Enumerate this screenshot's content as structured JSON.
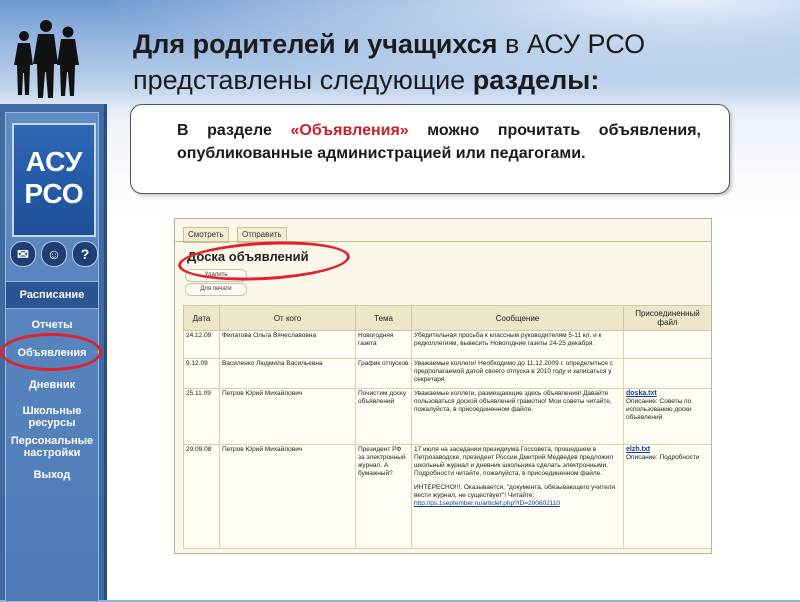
{
  "title": {
    "part1_bold": "Для родителей и учащихся",
    "part1_rest": " в АСУ РСО",
    "part2_rest": "представлены следующие ",
    "part2_bold": "разделы:"
  },
  "info": {
    "text_before": "В разделе ",
    "highlight": "«Объявления»",
    "text_after": " можно прочитать объявления, опубликованные администрацией или педагогами."
  },
  "sidebar": {
    "logo_line1": "АСУ",
    "logo_line2": "РСО",
    "icons": [
      "mail-icon",
      "users-icon",
      "help-icon"
    ],
    "items": [
      {
        "label": "Расписание"
      },
      {
        "label": "Отчеты"
      },
      {
        "label": "Объявления"
      },
      {
        "label": "Дневник"
      },
      {
        "label": "Школьные ресурсы"
      },
      {
        "label": "Персональные настройки"
      },
      {
        "label": "Выход"
      }
    ]
  },
  "board": {
    "tabs": [
      "Смотреть",
      "Отправить"
    ],
    "title": "Доска объявлений",
    "buttons": [
      "Удалить",
      "Для печати"
    ],
    "columns": [
      "Дата",
      "От кого",
      "Тема",
      "Сообщение",
      "Присоединенный файл"
    ],
    "rows": [
      {
        "date": "24.12.09",
        "from": "Филатова Ольга Вячеславовна",
        "topic": "Новогодняя газета",
        "message": "Убедительная просьба к классным руководителям 5-11 кл. и к редколлегиям, вывесить Новогодние газеты 24-25 декабря.",
        "file_name": "",
        "file_desc": ""
      },
      {
        "date": "9.12.09",
        "from": "Василенко Людмила Васильевна",
        "topic": "График отпусков",
        "message": "Уважаемые коллеги! Необходимо до 11.12.2009 г. определиться с предполагаемой датой своего отпуска в 2010 году и записаться у секретаря.",
        "file_name": "",
        "file_desc": ""
      },
      {
        "date": "25.11.09",
        "from": "Петров Юрий Михайлович",
        "topic": "Почистим доску объявлений",
        "message": "Уважаемые коллеги, размещающие здесь объявления! Давайте пользоваться доской объявлений грамотно! Мои советы читайте, пожалуйста, в присоединенном файле.",
        "file_name": "doska.txt",
        "file_desc": "Описание: Советы по использованию доски объявлений"
      },
      {
        "date": "29.09.08",
        "from": "Петров Юрий Михайлович",
        "topic": "Президент РФ за электронный журнал. А бумажный?",
        "message": "17 июля на заседании президиума Госсовета, прошедшем в Петрозаводске, президент России Дмитрий Медведев предложил школьный журнал и дневник школьника сделать электронными. Подробности читайте, пожалуйста, в присоединенном файле.",
        "message2": "ИНТЕРЕСНО!!!. Оказывается, \"документа, обязывающего учителя вести журнал, не существует\"! Читайте:",
        "url": "http://ps.1september.ru/articlef.php?ID=200602110",
        "file_name": "elzh.txt",
        "file_desc": "Описание: Подробности"
      }
    ]
  },
  "colors": {
    "sidebar": "#3f6ba3",
    "highlight_red": "#e3202b",
    "panel_bg": "#fbf8ea",
    "header_bg": "#eee6c8"
  }
}
